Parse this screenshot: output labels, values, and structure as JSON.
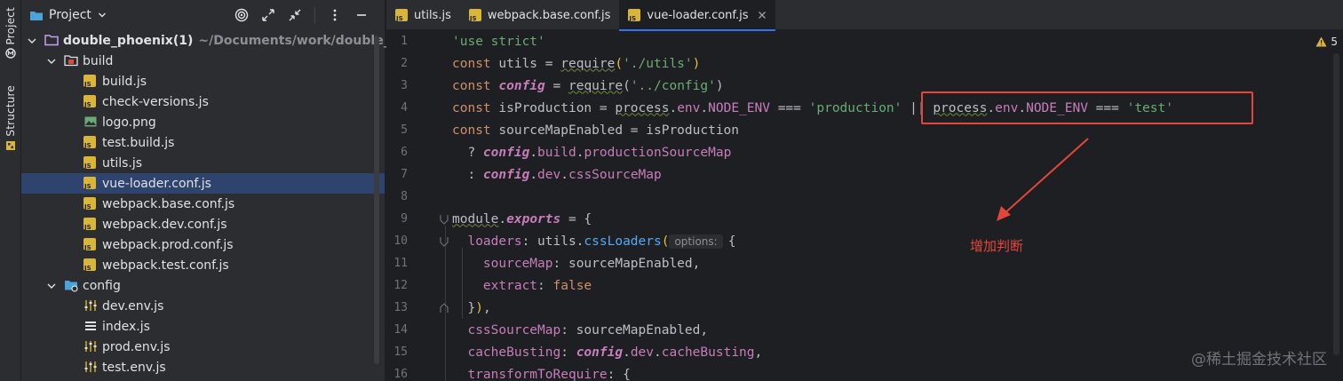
{
  "sidebar_strip": {
    "project_tab": "Project",
    "structure_tab": "Structure"
  },
  "project_panel": {
    "title": "Project",
    "tree": [
      {
        "label": "double_phoenix(1)",
        "hint": "~/Documents/work/double_",
        "type": "root",
        "depth": 0,
        "expanded": true
      },
      {
        "label": "build",
        "type": "folder",
        "depth": 1,
        "expanded": true
      },
      {
        "label": "build.js",
        "type": "js",
        "depth": 2
      },
      {
        "label": "check-versions.js",
        "type": "js",
        "depth": 2
      },
      {
        "label": "logo.png",
        "type": "image",
        "depth": 2
      },
      {
        "label": "test.build.js",
        "type": "js",
        "depth": 2
      },
      {
        "label": "utils.js",
        "type": "js",
        "depth": 2
      },
      {
        "label": "vue-loader.conf.js",
        "type": "js",
        "depth": 2,
        "selected": true
      },
      {
        "label": "webpack.base.conf.js",
        "type": "js",
        "depth": 2
      },
      {
        "label": "webpack.dev.conf.js",
        "type": "js",
        "depth": 2
      },
      {
        "label": "webpack.prod.conf.js",
        "type": "js",
        "depth": 2
      },
      {
        "label": "webpack.test.conf.js",
        "type": "js",
        "depth": 2
      },
      {
        "label": "config",
        "type": "folder-config",
        "depth": 1,
        "expanded": true
      },
      {
        "label": "dev.env.js",
        "type": "config-js",
        "depth": 2
      },
      {
        "label": "index.js",
        "type": "list-js",
        "depth": 2
      },
      {
        "label": "prod.env.js",
        "type": "config-js",
        "depth": 2
      },
      {
        "label": "test.env.js",
        "type": "config-js",
        "depth": 2
      }
    ]
  },
  "tabs": [
    {
      "label": "utils.js",
      "active": false
    },
    {
      "label": "webpack.base.conf.js",
      "active": false
    },
    {
      "label": "vue-loader.conf.js",
      "active": true
    }
  ],
  "editor": {
    "warning_count": "5",
    "lines": [
      {
        "n": "1",
        "tokens": [
          [
            "str",
            "'use strict'"
          ]
        ]
      },
      {
        "n": "2",
        "tokens": [
          [
            "kw",
            "const "
          ],
          [
            "plain",
            "utils = "
          ],
          [
            "plainu",
            "require"
          ],
          [
            "paren",
            "("
          ],
          [
            "str",
            "'./utils'"
          ],
          [
            "paren",
            ")"
          ]
        ]
      },
      {
        "n": "3",
        "tokens": [
          [
            "kw",
            "const "
          ],
          [
            "var",
            "config"
          ],
          [
            "plain",
            " = "
          ],
          [
            "plainu",
            "require"
          ],
          [
            "plain",
            "("
          ],
          [
            "str",
            "'../config'"
          ],
          [
            "plain",
            ")"
          ]
        ]
      },
      {
        "n": "4",
        "tokens": [
          [
            "kw",
            "const "
          ],
          [
            "plain",
            "isProduction = "
          ],
          [
            "plainu",
            "process"
          ],
          [
            "plain",
            "."
          ],
          [
            "prop",
            "env"
          ],
          [
            "plain",
            "."
          ],
          [
            "const",
            "NODE_ENV"
          ],
          [
            "plain",
            " === "
          ],
          [
            "str",
            "'production'"
          ],
          [
            "plain",
            " || "
          ],
          [
            "plainu",
            "process"
          ],
          [
            "plain",
            "."
          ],
          [
            "prop",
            "env"
          ],
          [
            "plain",
            "."
          ],
          [
            "const",
            "NODE_ENV"
          ],
          [
            "plain",
            " === "
          ],
          [
            "str",
            "'test'"
          ]
        ]
      },
      {
        "n": "5",
        "tokens": [
          [
            "kw",
            "const "
          ],
          [
            "plain",
            "sourceMapEnabled = isProduction"
          ]
        ]
      },
      {
        "n": "6",
        "tokens": [
          [
            "plain",
            "  ? "
          ],
          [
            "var",
            "config"
          ],
          [
            "plain",
            "."
          ],
          [
            "prop",
            "build"
          ],
          [
            "plain",
            "."
          ],
          [
            "prop",
            "productionSourceMap"
          ]
        ]
      },
      {
        "n": "7",
        "tokens": [
          [
            "plain",
            "  : "
          ],
          [
            "var",
            "config"
          ],
          [
            "plain",
            "."
          ],
          [
            "prop",
            "dev"
          ],
          [
            "plain",
            "."
          ],
          [
            "prop",
            "cssSourceMap"
          ]
        ]
      },
      {
        "n": "8",
        "tokens": []
      },
      {
        "n": "9",
        "tokens": [
          [
            "plainu",
            "module"
          ],
          [
            "plain",
            "."
          ],
          [
            "varkw",
            "exports"
          ],
          [
            "plain",
            " = {"
          ]
        ]
      },
      {
        "n": "10",
        "tokens": [
          [
            "prop",
            "  loaders"
          ],
          [
            "plain",
            ": utils."
          ],
          [
            "fn",
            "cssLoaders"
          ],
          [
            "paren",
            "("
          ],
          [
            "hint",
            "options:"
          ],
          [
            "plain",
            "{"
          ]
        ]
      },
      {
        "n": "11",
        "tokens": [
          [
            "prop",
            "    sourceMap"
          ],
          [
            "plain",
            ": sourceMapEnabled,"
          ]
        ]
      },
      {
        "n": "12",
        "tokens": [
          [
            "prop",
            "    extract"
          ],
          [
            "plain",
            ": "
          ],
          [
            "kw",
            "false"
          ]
        ]
      },
      {
        "n": "13",
        "tokens": [
          [
            "plain",
            "  }"
          ],
          [
            "paren",
            ")"
          ],
          [
            "plain",
            ","
          ]
        ]
      },
      {
        "n": "14",
        "tokens": [
          [
            "prop",
            "  cssSourceMap"
          ],
          [
            "plain",
            ": sourceMapEnabled,"
          ]
        ]
      },
      {
        "n": "15",
        "tokens": [
          [
            "prop",
            "  cacheBusting"
          ],
          [
            "plain",
            ": "
          ],
          [
            "var",
            "config"
          ],
          [
            "plain",
            "."
          ],
          [
            "prop",
            "dev"
          ],
          [
            "plain",
            "."
          ],
          [
            "prop",
            "cacheBusting"
          ],
          [
            "plain",
            ","
          ]
        ]
      },
      {
        "n": "16",
        "tokens": [
          [
            "prop",
            "  transformToRequire"
          ],
          [
            "plain",
            ": {"
          ]
        ]
      }
    ]
  },
  "annotation": {
    "label": "增加判断",
    "color": "#e5463b"
  },
  "watermark": "@稀土掘金技术社区"
}
